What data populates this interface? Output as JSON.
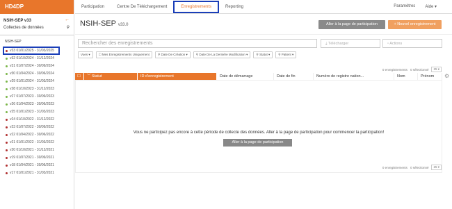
{
  "app": {
    "logo": "HD4DP"
  },
  "sidebar": {
    "header": "NSIH-SEP v33",
    "subheader": "Collectes de données",
    "title": "NSIH-SEP",
    "items": [
      {
        "label": "v33 01/01/2025 - 31/03/2025",
        "color": "#b03030"
      },
      {
        "label": "v32 01/10/2024 - 31/12/2024",
        "color": "#7ab648"
      },
      {
        "label": "v31 01/07/2024 - 30/09/2024",
        "color": "#7ab648"
      },
      {
        "label": "v30 01/04/2024 - 30/06/2024",
        "color": "#7ab648"
      },
      {
        "label": "v29 01/01/2024 - 31/03/2024",
        "color": "#7ab648"
      },
      {
        "label": "v28 01/10/2023 - 31/12/2023",
        "color": "#7ab648"
      },
      {
        "label": "v27 01/07/2023 - 30/09/2023",
        "color": "#7ab648"
      },
      {
        "label": "v26 01/04/2023 - 30/06/2023",
        "color": "#7ab648"
      },
      {
        "label": "v25 01/01/2023 - 31/03/2023",
        "color": "#7ab648"
      },
      {
        "label": "v24 01/10/2022 - 31/12/2022",
        "color": "#b03030"
      },
      {
        "label": "v23 01/07/2022 - 30/09/2022",
        "color": "#b03030"
      },
      {
        "label": "v22 01/04/2022 - 30/06/2022",
        "color": "#b03030"
      },
      {
        "label": "v21 01/01/2022 - 31/03/2022",
        "color": "#b03030"
      },
      {
        "label": "v20 01/10/2021 - 31/12/2021",
        "color": "#b03030"
      },
      {
        "label": "v19 01/07/2021 - 30/09/2021",
        "color": "#b03030"
      },
      {
        "label": "v18 01/04/2021 - 30/06/2021",
        "color": "#b03030"
      },
      {
        "label": "v17 01/01/2021 - 31/03/2021",
        "color": "#b03030"
      }
    ]
  },
  "nav": {
    "items": [
      "Participation",
      "Centre De Téléchargement",
      "Enregistrements",
      "Reporting"
    ],
    "params": "Paramètres",
    "help": "Aide ▾"
  },
  "main": {
    "title": "NSIH-SEP",
    "version": "v33.0",
    "btn_goto": "Aller à la page de participation",
    "btn_new": "+ Nouvel enregistrement",
    "search_placeholder": "Rechercher des enregistrements",
    "download": "Télécharger",
    "actions": "Actions",
    "filters": [
      "Vues ▾",
      "Mes Enregistrements Uniquement",
      "Date De Création ▾",
      "Date De La Dernière Modification ▾",
      "Statut ▾",
      "Patient ▾"
    ],
    "counts": {
      "records": "0 enregistrements",
      "selected": "0 sélectionné",
      "page_size": "25"
    },
    "columns": [
      "Statut",
      "ID d'enregistrement",
      "Date de démarrage",
      "Date de fin",
      "Numéro de registre nation...",
      "Nom",
      "Prénom"
    ],
    "empty_message": "Vous ne participez pas encore à cette période de collecte des données. Aller à la page de participation pour commencer la participation!",
    "empty_button": "Aller à la page de participation"
  }
}
